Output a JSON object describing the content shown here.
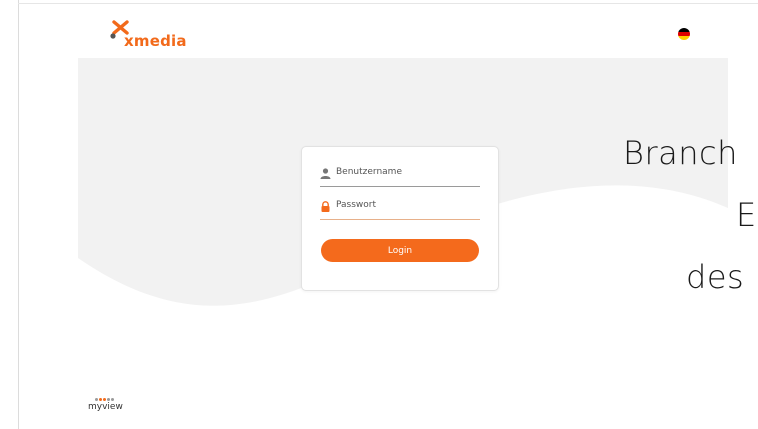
{
  "brand": {
    "name": "xmedia",
    "accent": "#f26a1b",
    "x_mark_dark": "#555555"
  },
  "language": {
    "flag": "de",
    "icon": "german-flag-icon"
  },
  "hero": {
    "background": "#f2f2f2",
    "tagline_lines": [
      "Branch",
      "E",
      "des"
    ]
  },
  "login": {
    "username_placeholder": "Benutzername",
    "username_icon": "user-icon",
    "password_placeholder": "Passwort",
    "password_icon": "lock-icon",
    "button_label": "Login",
    "button_color": "#f46a1c"
  },
  "footer": {
    "product_name": "myview"
  }
}
